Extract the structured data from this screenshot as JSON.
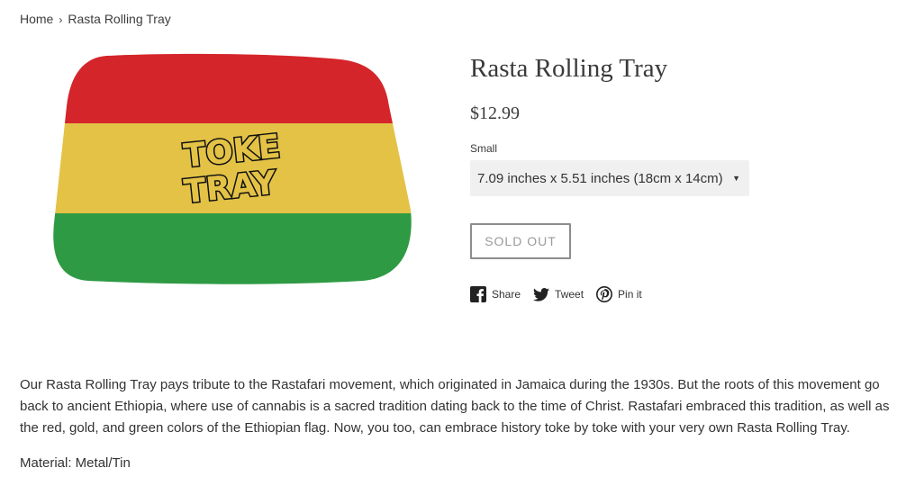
{
  "breadcrumb": {
    "home": "Home",
    "separator": "›",
    "current": "Rasta Rolling Tray"
  },
  "product": {
    "title": "Rasta Rolling Tray",
    "price": "$12.99",
    "variant_label": "Small",
    "variant_selected": "7.09 inches x 5.51 inches (18cm x 14cm)",
    "sold_out_label": "SOLD OUT",
    "image_logo_text": "TOKE TRAY",
    "colors": {
      "red": "#d4252a",
      "gold": "#e3c246",
      "green": "#2f9a44"
    }
  },
  "share": {
    "facebook": "Share",
    "twitter": "Tweet",
    "pinterest": "Pin it"
  },
  "description": {
    "body": "Our Rasta Rolling Tray pays tribute to the Rastafari movement, which originated in Jamaica during the 1930s. But the roots of this movement go back to ancient Ethiopia, where use of cannabis is a sacred tradition dating back to the time of Christ. Rastafari embraced this tradition, as well as the red, gold, and green colors of the Ethiopian flag. Now, you too, can embrace history toke by toke with your very own Rasta Rolling Tray.",
    "material": "Material: Metal/Tin"
  }
}
